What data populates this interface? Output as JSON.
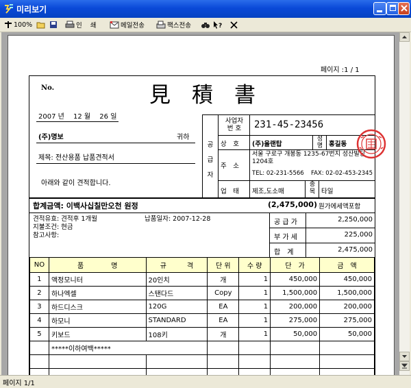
{
  "window": {
    "title": "미리보기"
  },
  "toolbar": {
    "zoom": "100%",
    "print_label": "인",
    "print2_label": "쇄",
    "email_label": "메일전송",
    "fax_label": "팩스전송"
  },
  "page_indicator": "페이지 :1 / 1",
  "status": {
    "page": "페이지 1/1"
  },
  "doc": {
    "no_label": "No.",
    "title": "見　積　書",
    "date": "2007 년　 12 월　 26 일",
    "client": "(주)명보",
    "client_suffix": "귀하",
    "subject": "제목: 전산용품 납품견적서",
    "greeting": "아래와 같이 견적합니다.",
    "supplier": {
      "side_label": [
        "공",
        "급",
        "자"
      ],
      "reg_label": "사업자\n번 호",
      "reg_number": "231-45-23456",
      "name_label": "상　호",
      "name": "(주)올랜탑",
      "rep_label": "성\n명",
      "rep_name": "홍길동",
      "addr_label": "주　소",
      "address": "서울 구로구 개봉동 1235-67번지 성산빌딩 1204호",
      "tel": "TEL: 02-231-5566",
      "fax": "FAX: 02-02-453-2345",
      "biz_label": "업　태",
      "biz_type": "제조,도소매",
      "item_label": "종\n목",
      "item": "타일"
    },
    "total_label": "합계금액: 이백사십칠만오천 원정",
    "total_amount": "(2,475,000)",
    "total_note": "원가에세액포함",
    "validity": "견적유효: 견적후 1개월",
    "delivery": "납품일자: 2007-12-28",
    "payment": "지불조건: 현금",
    "remarks": "참고사항:",
    "supply_label": "공 급 가",
    "supply_value": "2,250,000",
    "vat_label": "부 가 세",
    "vat_value": "225,000",
    "sum_label": "합　계",
    "sum_value": "2,475,000",
    "headers": {
      "no": "NO",
      "name": "품　　　　명",
      "spec": "규　　　격",
      "unit": "단 위",
      "qty": "수 량",
      "price": "단　가",
      "amount": "금　액"
    },
    "items": [
      {
        "no": "1",
        "name": "액정모니터",
        "spec": "20인치",
        "unit": "개",
        "qty": "1",
        "price": "450,000",
        "amount": "450,000"
      },
      {
        "no": "2",
        "name": "하나엑셀",
        "spec": "스탠다드",
        "unit": "Copy",
        "qty": "1",
        "price": "1,500,000",
        "amount": "1,500,000"
      },
      {
        "no": "3",
        "name": "하드디스크",
        "spec": "120G",
        "unit": "EA",
        "qty": "1",
        "price": "200,000",
        "amount": "200,000"
      },
      {
        "no": "4",
        "name": "하모니",
        "spec": "STANDARD",
        "unit": "EA",
        "qty": "1",
        "price": "275,000",
        "amount": "275,000"
      },
      {
        "no": "5",
        "name": "키보드",
        "spec": "108키",
        "unit": "개",
        "qty": "1",
        "price": "50,000",
        "amount": "50,000"
      }
    ],
    "end_marker": "*****이하여백*****"
  }
}
